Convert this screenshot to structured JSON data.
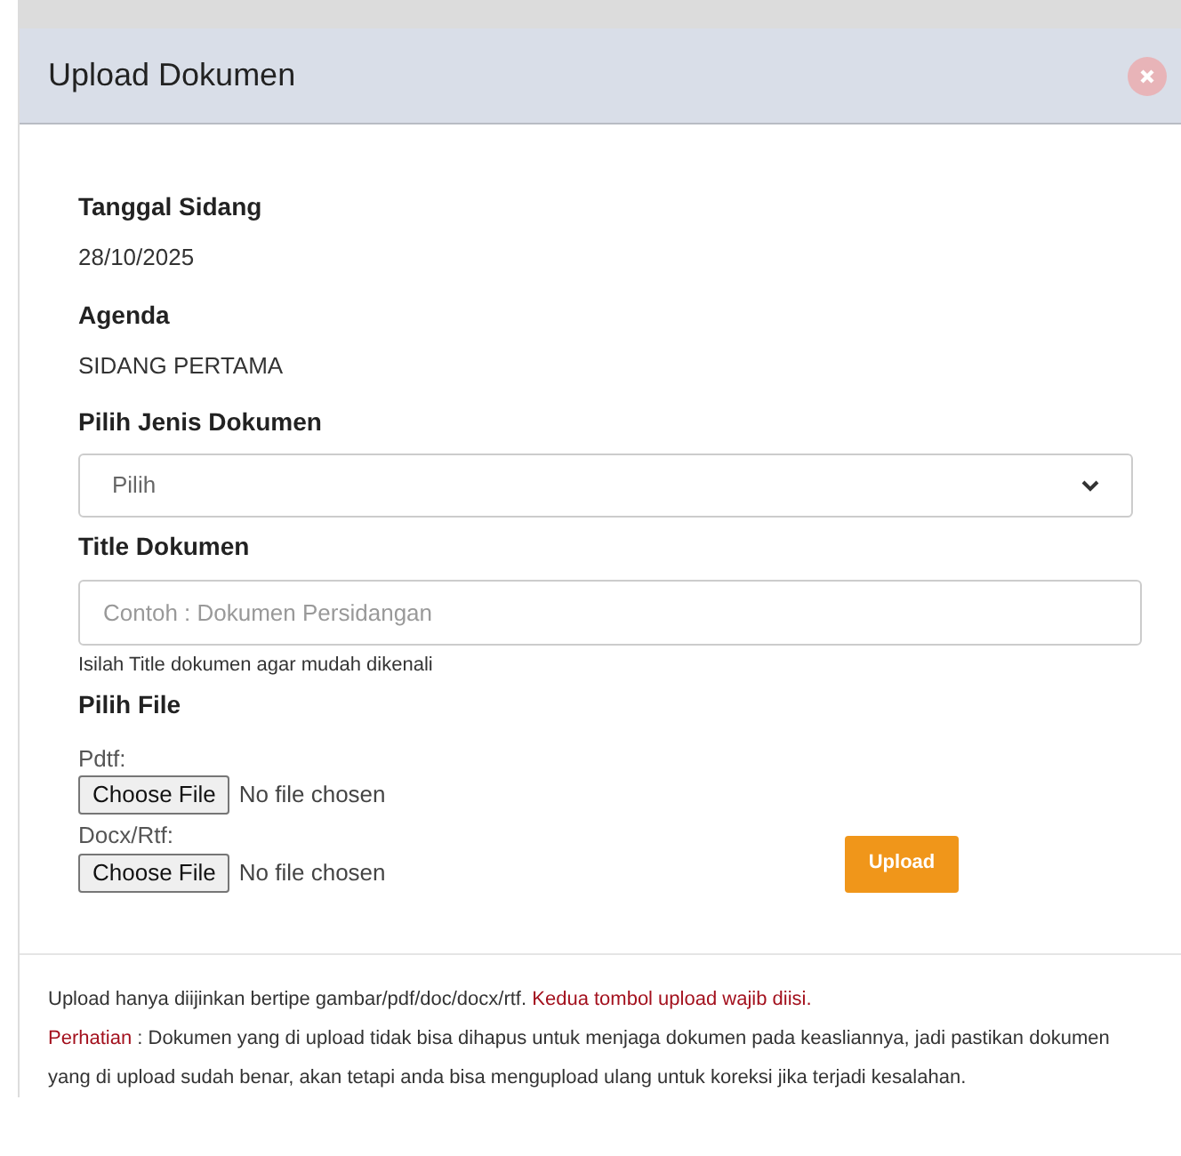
{
  "modal": {
    "title": "Upload Dokumen"
  },
  "fields": [
    {
      "label": "Tanggal Sidang",
      "value": "28/10/2025"
    },
    {
      "label": "Agenda",
      "value": "SIDANG PERTAMA"
    }
  ],
  "document_type": {
    "label": "Pilih Jenis Dokumen",
    "value": "Pilih"
  },
  "document_title": {
    "label": "Title Dokumen",
    "placeholder": "Contoh : Dokumen Persidangan",
    "help": "Isilah Title dokumen agar mudah dikenali"
  },
  "file_section": {
    "label": "Pilih File",
    "files": [
      {
        "label": "Pdtf:",
        "button": "Choose File",
        "status": "No file chosen"
      },
      {
        "label": "Docx/Rtf:",
        "button": "Choose File",
        "status": "No file chosen"
      }
    ]
  },
  "upload_button": "Upload",
  "notes": {
    "text": "Upload hanya diijinkan bertipe gambar/pdf/doc/docx/rtf.",
    "warning": "Kedua tombol upload wajib diisi.",
    "attention_label": "Perhatian",
    "attention_text": ": Dokumen yang di upload tidak bisa dihapus untuk menjaga dokumen pada keasliannya, jadi pastikan dokumen yang di upload sudah benar, akan tetapi anda bisa mengupload ulang untuk koreksi jika terjadi kesalahan."
  }
}
